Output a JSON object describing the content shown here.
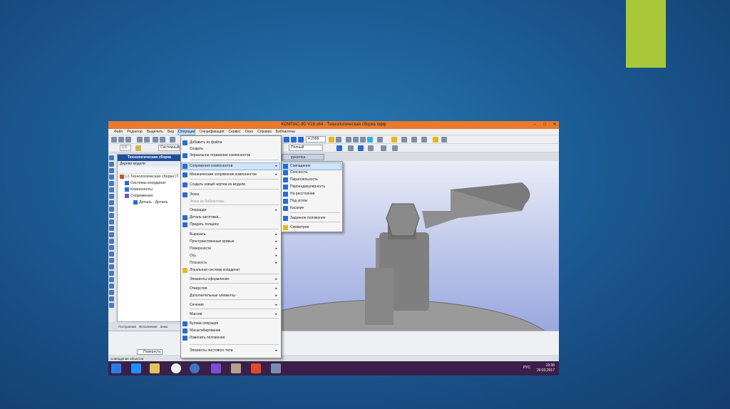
{
  "window": {
    "title": "КОМПАС-3D V16  x64 - Технологическая сборка пфф",
    "minimize": "–",
    "maximize": "□",
    "close": "✕"
  },
  "menubar": [
    "Файл",
    "Редактор",
    "Выделить",
    "Вид",
    "Операции",
    "Спецификация",
    "Сервис",
    "Окно",
    "Справка",
    "Библиотеки"
  ],
  "toolbar": {
    "scale_value": "1.0",
    "mode_value": "Системный",
    "zoom_value": "4.2998",
    "display_mode": "Полный"
  },
  "tree": {
    "header": "Технологическая сборка",
    "subheader": "Дерево модели",
    "items": [
      "(-) Технологическая сборка (Т...",
      "Системы координат",
      "Компоненты",
      "Сопряжения",
      "Деталь - Деталь"
    ],
    "tabs": [
      "Построение",
      "Исполнения",
      "Зоны"
    ]
  },
  "viewport": {
    "component_tab": "рукоятка"
  },
  "operations_menu": [
    {
      "label": "Добавить из файла",
      "arrow": false,
      "disabled": false,
      "hl": false
    },
    {
      "label": "Создать",
      "arrow": false,
      "disabled": false,
      "hl": false
    },
    {
      "label": "Зеркальное отражение компонентов",
      "arrow": false,
      "disabled": false,
      "hl": false
    },
    {
      "label": "Сопряжения компонентов",
      "arrow": true,
      "disabled": false,
      "hl": true
    },
    {
      "label": "Механические сопряжения компонентов",
      "arrow": true,
      "disabled": false,
      "hl": false
    },
    {
      "label": "Создать новый чертеж из модели",
      "arrow": false,
      "disabled": false,
      "hl": false
    },
    {
      "label": "Эскиз",
      "arrow": false,
      "disabled": false,
      "hl": false
    },
    {
      "label": "Эскиз из библиотеки...",
      "arrow": false,
      "disabled": true,
      "hl": false
    },
    {
      "label": "Операции",
      "arrow": true,
      "disabled": false,
      "hl": false
    },
    {
      "label": "Деталь-заготовка...",
      "arrow": false,
      "disabled": false,
      "hl": false
    },
    {
      "label": "Придать толщину",
      "arrow": false,
      "disabled": false,
      "hl": false
    },
    {
      "label": "Вырезать",
      "arrow": true,
      "disabled": false,
      "hl": false
    },
    {
      "label": "Пространственные кривые",
      "arrow": true,
      "disabled": false,
      "hl": false
    },
    {
      "label": "Поверхности",
      "arrow": true,
      "disabled": false,
      "hl": false
    },
    {
      "label": "Ось",
      "arrow": true,
      "disabled": false,
      "hl": false
    },
    {
      "label": "Плоскость",
      "arrow": true,
      "disabled": false,
      "hl": false
    },
    {
      "label": "Локальная система координат",
      "arrow": false,
      "disabled": false,
      "hl": false
    },
    {
      "label": "Элементы оформления",
      "arrow": true,
      "disabled": false,
      "hl": false
    },
    {
      "label": "Отверстия",
      "arrow": true,
      "disabled": false,
      "hl": false
    },
    {
      "label": "Дополнительные элементы",
      "arrow": true,
      "disabled": false,
      "hl": false
    },
    {
      "label": "Сечение",
      "arrow": true,
      "disabled": false,
      "hl": false
    },
    {
      "label": "Массив",
      "arrow": true,
      "disabled": false,
      "hl": false
    },
    {
      "label": "Булева операция",
      "arrow": false,
      "disabled": false,
      "hl": false
    },
    {
      "label": "Масштабирование",
      "arrow": false,
      "disabled": false,
      "hl": false
    },
    {
      "label": "Изменить положение",
      "arrow": false,
      "disabled": false,
      "hl": false
    },
    {
      "label": "Элементы листового тела",
      "arrow": true,
      "disabled": false,
      "hl": false
    }
  ],
  "mates_submenu": [
    {
      "label": "Совпадение",
      "hl": true
    },
    {
      "label": "Соосность",
      "hl": false
    },
    {
      "label": "Параллельность",
      "hl": false
    },
    {
      "label": "Перпендикулярность",
      "hl": false
    },
    {
      "label": "На расстоянии",
      "hl": false
    },
    {
      "label": "Под углом",
      "hl": false
    },
    {
      "label": "Касание",
      "hl": false
    },
    {
      "label": "Заданное положение",
      "hl": false
    },
    {
      "label": "Симметрия",
      "hl": false
    }
  ],
  "property_panel": {
    "rotate_button": "Повернуть"
  },
  "status": {
    "text": "Совпадение объектов"
  },
  "taskbar": {
    "lang": "РУС",
    "time": "19:38",
    "date": "20.03.2017"
  },
  "colors": {
    "accent": "#a8c83a",
    "titlebar": "#e87a2e",
    "menu_highlight": "#d1e3f6"
  }
}
